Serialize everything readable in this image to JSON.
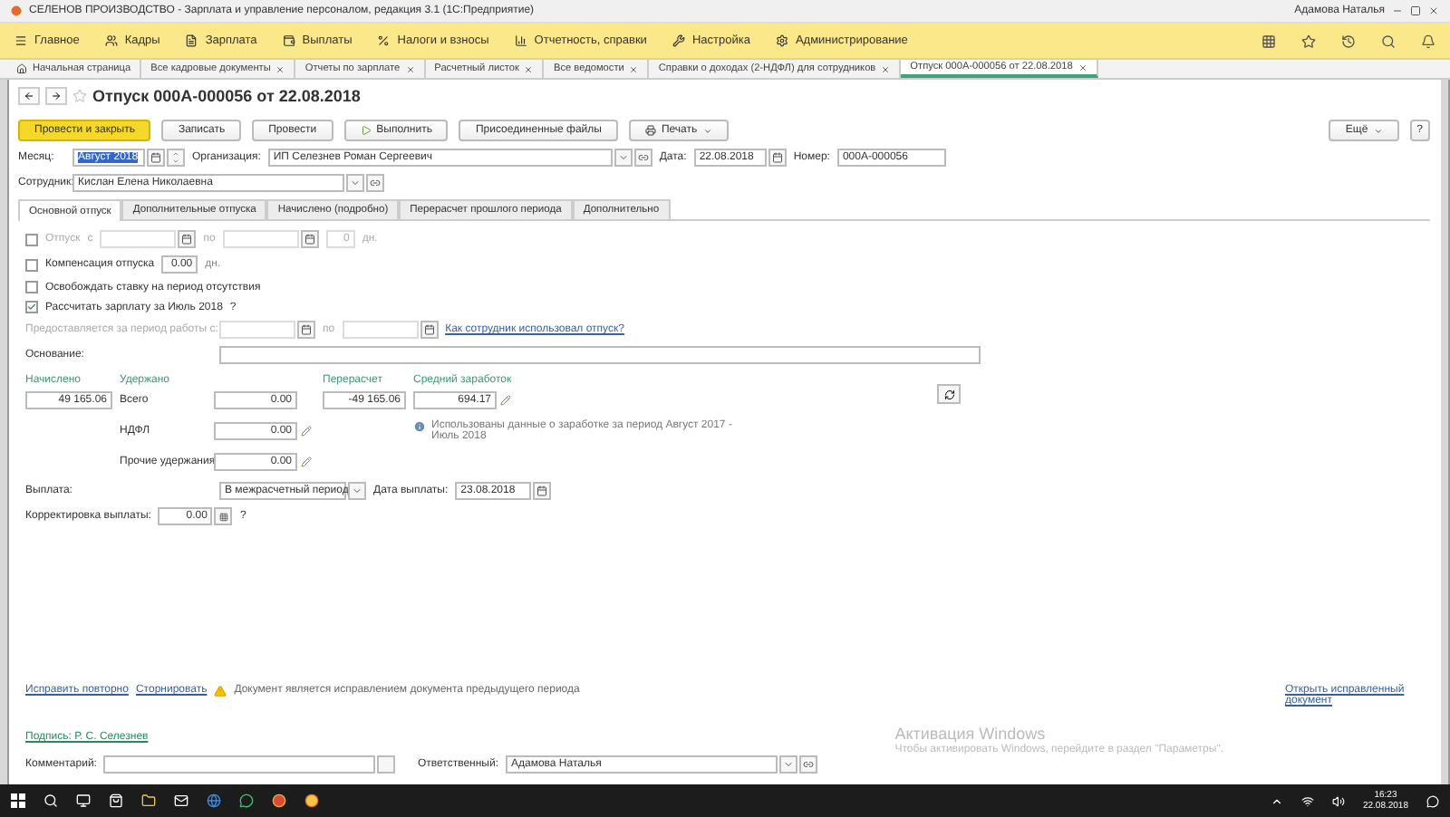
{
  "window": {
    "title": "СЕЛЕНОВ ПРОИЗВОДСТВО - Зарплата и управление персоналом, редакция 3.1 (1С:Предприятие)",
    "user": "Адамова Наталья"
  },
  "sections": [
    {
      "label": "Главное"
    },
    {
      "label": "Кадры"
    },
    {
      "label": "Зарплата"
    },
    {
      "label": "Выплаты"
    },
    {
      "label": "Налоги и взносы"
    },
    {
      "label": "Отчетность, справки"
    },
    {
      "label": "Настройка"
    },
    {
      "label": "Администрирование"
    }
  ],
  "open_tabs": [
    {
      "label": "Начальная страница",
      "selected": false,
      "kind": "home"
    },
    {
      "label": "Все кадровые документы",
      "selected": false,
      "kind": "tab"
    },
    {
      "label": "Отчеты по зарплате",
      "selected": false,
      "kind": "tab"
    },
    {
      "label": "Расчетный листок",
      "selected": false,
      "kind": "tab"
    },
    {
      "label": "Все ведомости",
      "selected": false,
      "kind": "tab"
    },
    {
      "label": "Справки о доходах (2-НДФЛ) для сотрудников",
      "selected": false,
      "kind": "tab"
    },
    {
      "label": "Отпуск 000А-000056 от 22.08.2018",
      "selected": true,
      "kind": "tab"
    }
  ],
  "form": {
    "title": "Отпуск 000А-000056 от 22.08.2018",
    "toolbar": [
      {
        "label": "Провести и закрыть",
        "kind": "primary"
      },
      {
        "label": "Записать",
        "kind": "plain"
      },
      {
        "label": "Провести",
        "kind": "plain"
      },
      {
        "label": "Выполнить",
        "kind": "icon"
      },
      {
        "label": "Присоединенные файлы",
        "kind": "plain"
      },
      {
        "label": "Печать",
        "kind": "menu"
      }
    ],
    "more": "Ещё",
    "help": "?",
    "header_fields": [
      {
        "label": "Месяц:",
        "value": "Август 2018",
        "kind": "period",
        "highlighted": true
      },
      {
        "label": "Организация:",
        "value": "ИП Селезнев Роман Сергеевич",
        "kind": "select",
        "highlighted": false
      },
      {
        "label": "Дата:",
        "value": "22.08.2018",
        "kind": "date",
        "highlighted": false
      },
      {
        "label": "Номер:",
        "value": "000А-000056",
        "kind": "text",
        "highlighted": false
      }
    ],
    "employee": {
      "label": "Сотрудник:",
      "value": "Кислан Елена Николаевна"
    },
    "tabs": [
      {
        "label": "Основной отпуск",
        "selected": true
      },
      {
        "label": "Дополнительные отпуска",
        "selected": false
      },
      {
        "label": "Начислено (подробно)",
        "selected": false
      },
      {
        "label": "Перерасчет прошлого периода",
        "selected": false
      },
      {
        "label": "Дополнительно",
        "selected": false
      }
    ],
    "vacation": {
      "label": "Отпуск",
      "checked": false,
      "disabled": true,
      "from_label": "с",
      "to_label": "по",
      "days": "0",
      "days_unit": "дн."
    },
    "compensation": {
      "label": "Компенсация отпуска",
      "checked": false,
      "value": "0.00",
      "unit": "дн."
    },
    "free_rate": {
      "label": "Освобождать ставку на период отсутствия",
      "checked": false
    },
    "calc_salary": {
      "label": "Рассчитать зарплату за Июль 2018",
      "checked": true,
      "help": "?"
    },
    "period": {
      "label": "Предоставляется за период работы с:",
      "to_label": "по",
      "disabled": true,
      "link": "Как сотрудник использовал отпуск?"
    },
    "basis": {
      "label": "Основание:"
    },
    "accrued": {
      "label": "Начислено",
      "value": "49 165.06"
    },
    "withheld": {
      "label": "Удержано",
      "rows": [
        {
          "label": "Всего",
          "value": "0.00",
          "editable": false
        },
        {
          "label": "НДФЛ",
          "value": "0.00",
          "editable": true
        },
        {
          "label": "Прочие удержания",
          "value": "0.00",
          "editable": true
        }
      ]
    },
    "recalc": {
      "label": "Перерасчет",
      "value": "-49 165.06"
    },
    "average": {
      "label": "Средний заработок",
      "value": "694.17",
      "editable": true,
      "note": "Использованы данные о заработке за период Август 2017 - Июль 2018"
    },
    "payment": {
      "label": "Выплата:",
      "value": "В межрасчетный период",
      "date_label": "Дата выплаты:",
      "date": "23.08.2018"
    },
    "correction": {
      "label": "Корректировка выплаты:",
      "value": "0.00",
      "help": "?"
    },
    "actions": [
      "Исправить повторно",
      "Сторнировать"
    ],
    "warning": "Документ является исправлением документа предыдущего периода",
    "open_link": "Открыть исправленный документ",
    "signature": "Подпись: Р. С. Селезнев",
    "comment": {
      "label": "Комментарий:"
    },
    "responsible": {
      "label": "Ответственный:",
      "value": "Адамова Наталья"
    }
  },
  "activation": {
    "title": "Активация Windows",
    "text": "Чтобы активировать Windows, перейдите в раздел \"Параметры\"."
  },
  "taskbar": {
    "time": "16:23",
    "date": "22.08.2018"
  }
}
